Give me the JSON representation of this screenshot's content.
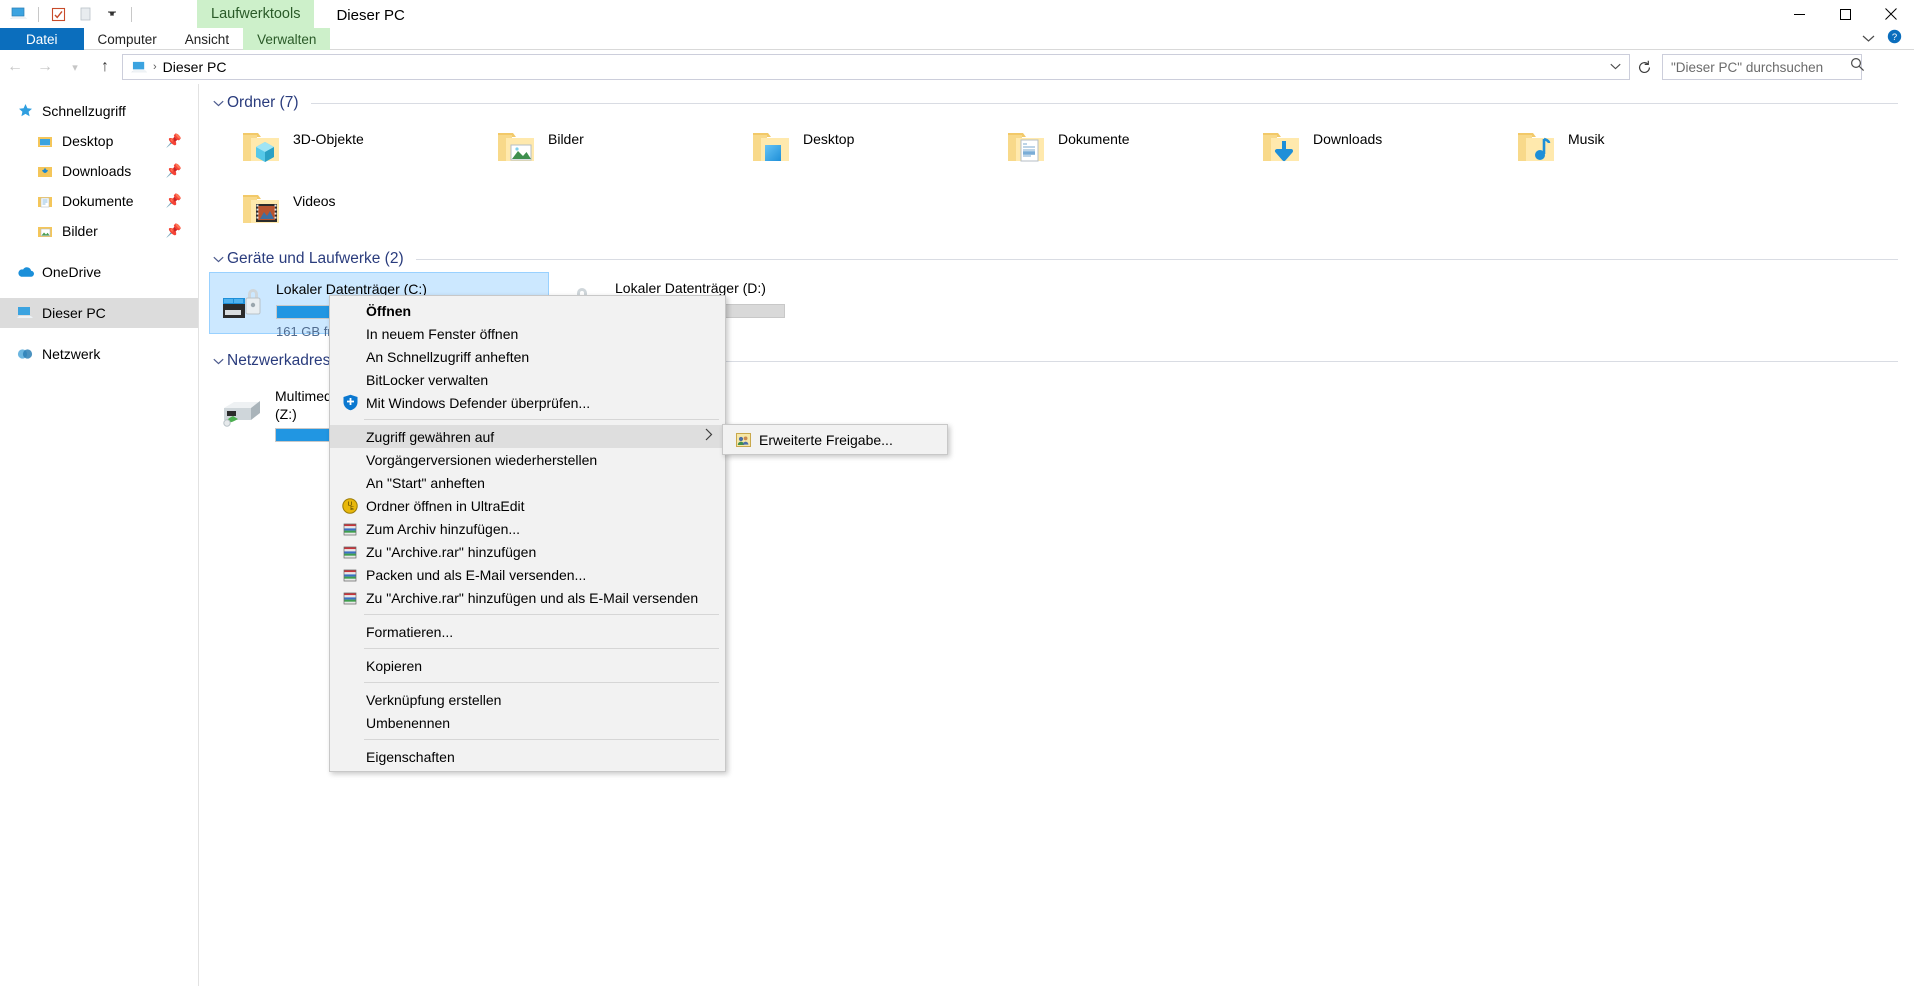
{
  "window": {
    "title": "Dieser PC",
    "contextual_tab_group": "Laufwerktools",
    "quick_access": [
      "pc-icon",
      "properties-icon",
      "new-folder-icon",
      "customize-dropdown-icon"
    ],
    "controls": {
      "minimize": "─",
      "maximize": "❐",
      "close": "✕"
    }
  },
  "ribbon": {
    "tabs": [
      {
        "label": "Datei",
        "style": "file"
      },
      {
        "label": "Computer",
        "style": "normal"
      },
      {
        "label": "Ansicht",
        "style": "normal"
      },
      {
        "label": "Verwalten",
        "style": "manage"
      }
    ],
    "right": {
      "collapse_icon": "chevron-down-icon",
      "help_icon": "help-icon"
    }
  },
  "address": {
    "back_icon": "back-arrow-icon",
    "forward_icon": "forward-arrow-icon",
    "recent_icon": "chevron-down-icon",
    "up_icon": "up-arrow-icon",
    "crumb_icon": "this-pc-icon",
    "crumb_separator": "›",
    "path": "Dieser PC",
    "dropdown_caret": "⌄",
    "refresh_icon": "refresh-icon"
  },
  "search": {
    "placeholder": "\"Dieser PC\" durchsuchen",
    "value": "",
    "icon": "search-icon"
  },
  "sidebar": {
    "items": [
      {
        "label": "Schnellzugriff",
        "icon": "star-pin-icon",
        "level": 0,
        "pinned": false,
        "selected": false
      },
      {
        "label": "Desktop",
        "icon": "desktop-folder-icon",
        "level": 1,
        "pinned": true,
        "selected": false
      },
      {
        "label": "Downloads",
        "icon": "downloads-folder-icon",
        "level": 1,
        "pinned": true,
        "selected": false
      },
      {
        "label": "Dokumente",
        "icon": "documents-folder-icon",
        "level": 1,
        "pinned": true,
        "selected": false
      },
      {
        "label": "Bilder",
        "icon": "pictures-folder-icon",
        "level": 1,
        "pinned": true,
        "selected": false
      },
      {
        "label": "OneDrive",
        "icon": "onedrive-cloud-icon",
        "level": 0,
        "pinned": false,
        "selected": false
      },
      {
        "label": "Dieser PC",
        "icon": "this-pc-icon",
        "level": 0,
        "pinned": false,
        "selected": true
      },
      {
        "label": "Netzwerk",
        "icon": "network-icon",
        "level": 0,
        "pinned": false,
        "selected": false
      }
    ]
  },
  "content": {
    "groups": [
      {
        "title": "Ordner (7)",
        "kind": "folders",
        "expanded": true,
        "items": [
          {
            "name": "3D-Objekte",
            "icon": "folder-3d-objects-icon"
          },
          {
            "name": "Bilder",
            "icon": "folder-pictures-icon"
          },
          {
            "name": "Desktop",
            "icon": "folder-desktop-icon"
          },
          {
            "name": "Dokumente",
            "icon": "folder-documents-icon"
          },
          {
            "name": "Downloads",
            "icon": "folder-downloads-icon"
          },
          {
            "name": "Musik",
            "icon": "folder-music-icon"
          },
          {
            "name": "Videos",
            "icon": "folder-videos-icon"
          }
        ]
      },
      {
        "title": "Geräte und Laufwerke (2)",
        "kind": "drives",
        "expanded": true,
        "items": [
          {
            "name": "Lokaler Datenträger (C:)",
            "free": "161 GB fre",
            "fill_percent": 48,
            "icon": "drive-bitlocker-windows-icon",
            "selected": true
          },
          {
            "name": "Lokaler Datenträger (D:)",
            "free": "",
            "fill_percent": 26,
            "icon": "drive-bitlocker-icon",
            "selected": false
          }
        ]
      },
      {
        "title": "Netzwerkadressen (1)",
        "kind": "network",
        "expanded": true,
        "items": [
          {
            "name": "Multimedi",
            "name2": "(Z:)",
            "fill_percent": 100,
            "icon": "network-drive-icon",
            "selected": false
          }
        ]
      }
    ]
  },
  "context_menu": {
    "items": [
      {
        "label": "Öffnen",
        "bold": true,
        "icon": "",
        "accel": "Ö",
        "divider_after": false
      },
      {
        "label": "In neuem Fenster öffnen",
        "bold": false,
        "icon": "",
        "accel": "I",
        "divider_after": false
      },
      {
        "label": "An Schnellzugriff anheften",
        "bold": false,
        "icon": "",
        "accel": "",
        "divider_after": false
      },
      {
        "label": "BitLocker verwalten",
        "bold": false,
        "icon": "",
        "accel": "B",
        "divider_after": false
      },
      {
        "label": "Mit Windows Defender überprüfen...",
        "bold": false,
        "icon": "defender-shield-icon",
        "accel": "",
        "divider_after": true
      },
      {
        "label": "Zugriff gewähren auf",
        "bold": false,
        "icon": "",
        "accel": "g",
        "submenu": true,
        "highlighted": true,
        "divider_after": false
      },
      {
        "label": "Vorgängerversionen wiederherstellen",
        "bold": false,
        "icon": "",
        "accel": "ä",
        "divider_after": false
      },
      {
        "label": "An \"Start\" anheften",
        "bold": false,
        "icon": "",
        "accel": "h",
        "divider_after": false
      },
      {
        "label": "Ordner öffnen in UltraEdit",
        "bold": false,
        "icon": "ultraedit-icon",
        "accel": "",
        "divider_after": false
      },
      {
        "label": "Zum Archiv hinzufügen...",
        "bold": false,
        "icon": "winrar-icon",
        "accel": "h",
        "divider_after": false
      },
      {
        "label": "Zu \"Archive.rar\" hinzufügen",
        "bold": false,
        "icon": "winrar-icon",
        "accel": "Z",
        "divider_after": false
      },
      {
        "label": "Packen und als E-Mail versenden...",
        "bold": false,
        "icon": "winrar-icon",
        "accel": "",
        "divider_after": false
      },
      {
        "label": "Zu \"Archive.rar\" hinzufügen und als E-Mail versenden",
        "bold": false,
        "icon": "winrar-icon",
        "accel": "E",
        "divider_after": true
      },
      {
        "label": "Formatieren...",
        "bold": false,
        "icon": "",
        "accel": "o",
        "divider_after": true
      },
      {
        "label": "Kopieren",
        "bold": false,
        "icon": "",
        "accel": "K",
        "divider_after": true
      },
      {
        "label": "Verknüpfung erstellen",
        "bold": false,
        "icon": "",
        "accel": "V",
        "divider_after": false
      },
      {
        "label": "Umbenennen",
        "bold": false,
        "icon": "",
        "accel": "U",
        "divider_after": true
      },
      {
        "label": "Eigenschaften",
        "bold": false,
        "icon": "",
        "accel": "i",
        "divider_after": false
      }
    ],
    "submenu": {
      "items": [
        {
          "label": "Erweiterte Freigabe...",
          "icon": "share-users-icon"
        }
      ]
    }
  },
  "colors": {
    "accent": "#0b6ebd",
    "selection": "#cce8ff",
    "group_header": "#2a3c7d",
    "contextual_tab": "#cdf0ca",
    "bar_fill": "#2196e2",
    "menu_bg": "#f2f2f2",
    "menu_highlight": "#dedede"
  }
}
